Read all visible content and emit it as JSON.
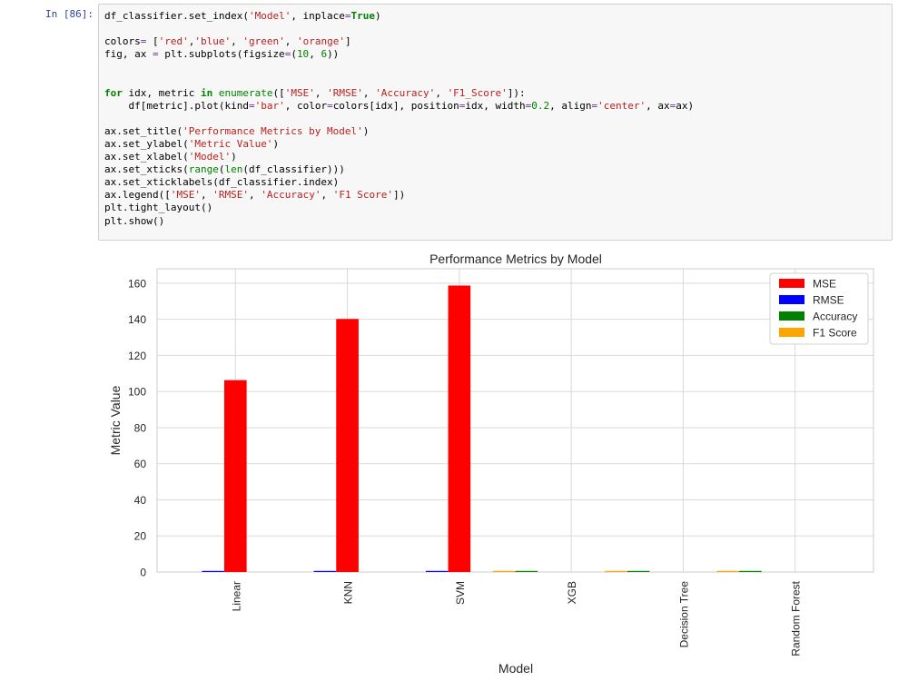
{
  "cell": {
    "prompt": "In [86]:",
    "code_lines": [
      "df_classifier.set_index('Model', inplace=True)",
      "",
      "colors= ['red','blue', 'green', 'orange']",
      "fig, ax = plt.subplots(figsize=(10, 6))",
      "",
      "",
      "for idx, metric in enumerate(['MSE', 'RMSE', 'Accuracy', 'F1_Score']):",
      "    df[metric].plot(kind='bar', color=colors[idx], position=idx, width=0.2, align='center', ax=ax)",
      "",
      "ax.set_title('Performance Metrics by Model')",
      "ax.set_ylabel('Metric Value')",
      "ax.set_xlabel('Model')",
      "ax.set_xticks(range(len(df_classifier)))",
      "ax.set_xticklabels(df_classifier.index)",
      "ax.legend(['MSE', 'RMSE', 'Accuracy', 'F1 Score'])",
      "plt.tight_layout()",
      "plt.show()"
    ]
  },
  "colors": {
    "mse": "#ff0000",
    "rmse": "#0000ff",
    "accuracy": "#008000",
    "f1": "#ffa500"
  },
  "chart_data": {
    "type": "bar",
    "title": "Performance Metrics by Model",
    "xlabel": "Model",
    "ylabel": "Metric Value",
    "ylim": [
      0,
      168
    ],
    "yticks": [
      0,
      20,
      40,
      60,
      80,
      100,
      120,
      140,
      160
    ],
    "categories": [
      "Linear",
      "KNN",
      "SVM",
      "XGB",
      "Decision Tree",
      "Random Forest"
    ],
    "series": [
      {
        "name": "MSE",
        "color": "#ff0000",
        "values": [
          106.3,
          140.2,
          158.7,
          0,
          0,
          0
        ]
      },
      {
        "name": "RMSE",
        "color": "#0000ff",
        "values": [
          0.6,
          0.6,
          0.6,
          0,
          0,
          0
        ]
      },
      {
        "name": "Accuracy",
        "color": "#008000",
        "values": [
          0,
          0,
          0,
          0.6,
          0.6,
          0.6
        ]
      },
      {
        "name": "F1 Score",
        "color": "#ffa500",
        "values": [
          0,
          0,
          0,
          0.6,
          0.6,
          0.6
        ]
      }
    ],
    "grid": true,
    "legend": "top-right"
  }
}
